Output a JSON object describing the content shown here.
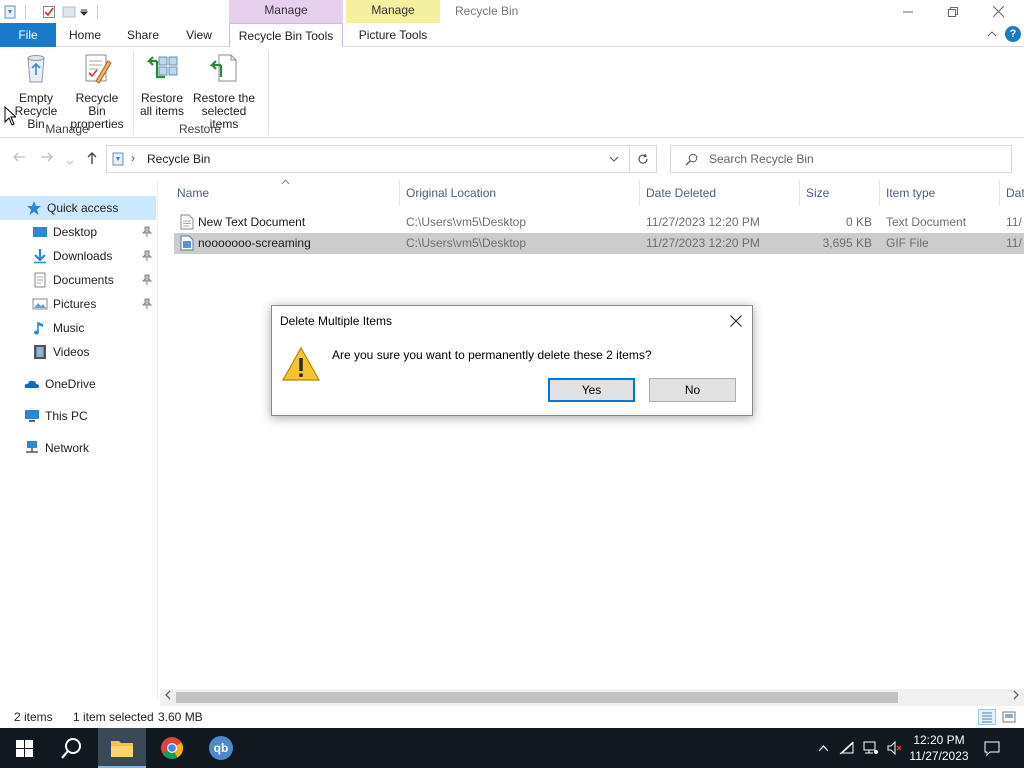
{
  "window": {
    "title": "Recycle Bin",
    "contextual_headers": [
      "Manage",
      "Manage"
    ],
    "controls": [
      "minimize",
      "restore",
      "close"
    ]
  },
  "ribbon_tabs": [
    {
      "label": "File",
      "active": false
    },
    {
      "label": "Home",
      "active": false
    },
    {
      "label": "Share",
      "active": false
    },
    {
      "label": "View",
      "active": false
    },
    {
      "label": "Recycle Bin Tools",
      "active": true
    },
    {
      "label": "Picture Tools",
      "active": false
    }
  ],
  "ribbon": {
    "buttons": [
      {
        "label1": "Empty",
        "label2": "Recycle Bin",
        "icon": "empty-recycle-bin-icon"
      },
      {
        "label1": "Recycle Bin",
        "label2": "properties",
        "icon": "recycle-bin-properties-icon"
      },
      {
        "label1": "Restore",
        "label2": "all items",
        "icon": "restore-all-icon"
      },
      {
        "label1": "Restore the",
        "label2": "selected items",
        "icon": "restore-selected-icon"
      }
    ],
    "groups": [
      "Manage",
      "Restore"
    ],
    "help": "?"
  },
  "address": {
    "path": "Recycle Bin",
    "separator": "›",
    "search_placeholder": "Search Recycle Bin"
  },
  "nav_pane": {
    "items": [
      {
        "label": "Quick access",
        "icon": "star-icon",
        "selected": true,
        "pinned": false,
        "indent": 1
      },
      {
        "label": "Desktop",
        "icon": "desktop-icon",
        "selected": false,
        "pinned": true,
        "indent": 2
      },
      {
        "label": "Downloads",
        "icon": "download-icon",
        "selected": false,
        "pinned": true,
        "indent": 2
      },
      {
        "label": "Documents",
        "icon": "documents-icon",
        "selected": false,
        "pinned": true,
        "indent": 2
      },
      {
        "label": "Pictures",
        "icon": "pictures-icon",
        "selected": false,
        "pinned": true,
        "indent": 2
      },
      {
        "label": "Music",
        "icon": "music-icon",
        "selected": false,
        "pinned": false,
        "indent": 2
      },
      {
        "label": "Videos",
        "icon": "videos-icon",
        "selected": false,
        "pinned": false,
        "indent": 2
      },
      {
        "label": "OneDrive",
        "icon": "onedrive-icon",
        "selected": false,
        "pinned": false,
        "indent": 1
      },
      {
        "label": "This PC",
        "icon": "this-pc-icon",
        "selected": false,
        "pinned": false,
        "indent": 1
      },
      {
        "label": "Network",
        "icon": "network-icon",
        "selected": false,
        "pinned": false,
        "indent": 1
      }
    ]
  },
  "file_list": {
    "columns": [
      "Name",
      "Original Location",
      "Date Deleted",
      "Size",
      "Item type",
      "Dat"
    ],
    "rows": [
      {
        "name": "New Text Document",
        "location": "C:\\Users\\vm5\\Desktop",
        "date_deleted": "11/27/2023 12:20 PM",
        "size": "0 KB",
        "type": "Text Document",
        "date_mod": "11/",
        "selected": false,
        "icon": "text-file-icon"
      },
      {
        "name": "nooooooo-screaming",
        "location": "C:\\Users\\vm5\\Desktop",
        "date_deleted": "11/27/2023 12:20 PM",
        "size": "3,695 KB",
        "type": "GIF File",
        "date_mod": "11/",
        "selected": true,
        "icon": "gif-file-icon"
      }
    ]
  },
  "status_bar": {
    "item_count": "2 items",
    "selection": "1 item selected",
    "selection_size": "3.60 MB"
  },
  "dialog": {
    "title": "Delete Multiple Items",
    "message": "Are you sure you want to permanently delete these 2 items?",
    "yes_label": "Yes",
    "no_label": "No",
    "close_glyph": "✕"
  },
  "taskbar": {
    "apps": [
      "start",
      "search",
      "file-explorer",
      "chrome",
      "qbittorrent"
    ],
    "qb_label": "qb",
    "time": "12:20 PM",
    "date": "11/27/2023"
  },
  "colors": {
    "accent": "#1979ca",
    "selection": "#cce8ff",
    "selected_row": "#cccccc",
    "taskbar": "#101820",
    "manage_purple": "#e7cfee",
    "manage_yellow": "#f5f0a0"
  }
}
